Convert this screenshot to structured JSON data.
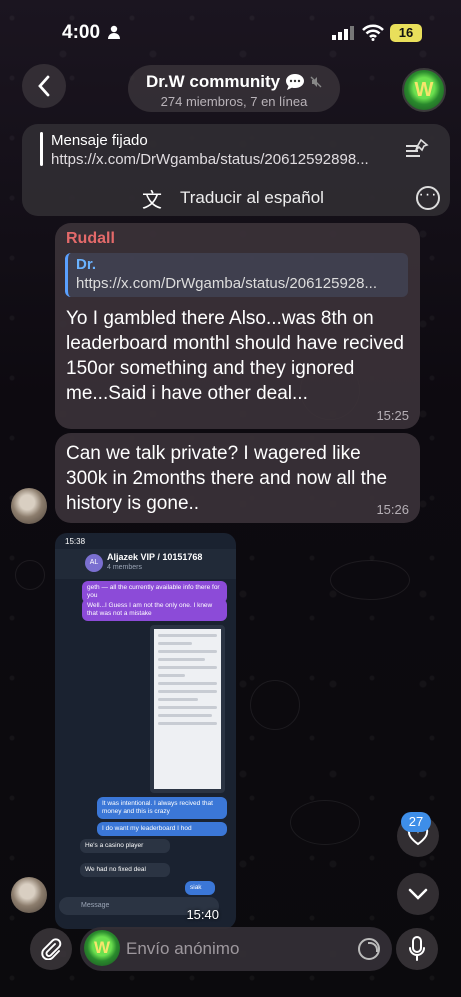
{
  "status_bar": {
    "time": "4:00",
    "battery": "16"
  },
  "header": {
    "title": "Dr.W community",
    "subtitle": "274 miembros, 7 en línea",
    "avatar_letter": "W"
  },
  "pinned": {
    "label": "Mensaje fijado",
    "text": "https://x.com/DrWgamba/status/20612592898...",
    "translate": "Traducir al español"
  },
  "messages": [
    {
      "sender": "Rudall",
      "reply_name": "Dr.",
      "reply_text": "https://x.com/DrWgamba/status/206125928...",
      "text": "Yo I gambled there Also...was 8th on leaderboard monthl should have recived 150or something and they ignored me...Said i have other deal...",
      "time": "15:25"
    },
    {
      "text": "Can we talk private? I wagered like 300k in 2months there and now all the history is gone..",
      "time": "15:26"
    }
  ],
  "screenshot": {
    "status_time": "15:38",
    "chat_title": "Aljazek VIP / 10151768",
    "chat_sub": "4 members",
    "msg_a": "geth — all the currently available info there for you",
    "msg_b": "Well...I Guess I am not the only one. I knew that was not a mistake",
    "msg_c": "It was intentional. I always recived that money and this is crazy",
    "msg_d": "I do want my leaderboard I hod",
    "msg_e": "He's a casino player",
    "msg_f": "We had no fixed deal",
    "msg_g": "siak",
    "input_placeholder": "Message",
    "time": "15:40"
  },
  "reactions": {
    "count": "27"
  },
  "input": {
    "placeholder": "Envío anónimo",
    "avatar_letter": "W"
  }
}
